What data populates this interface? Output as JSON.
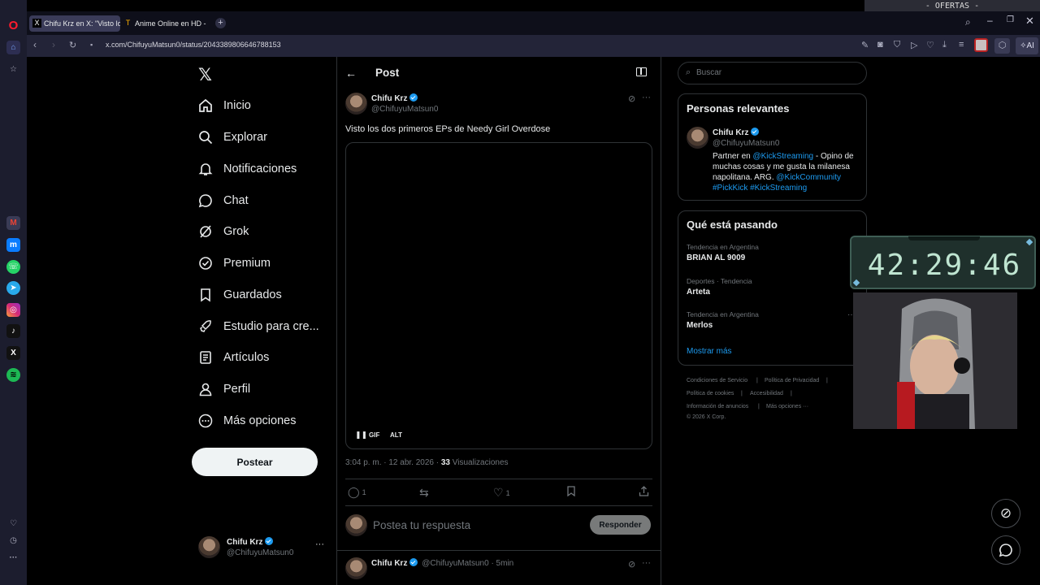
{
  "browser": {
    "ofertas_label": "- OFERTAS -",
    "tabs": [
      {
        "title": "Chifu Krz en X: \"Visto los dos",
        "favicon": "x-icon"
      },
      {
        "title": "Anime Online en HD - Tio Anime",
        "favicon": "tioanime-icon"
      }
    ],
    "url": "x.com/ChifuyuMatsun0/status/2043389806646788153",
    "ai_label": "AI"
  },
  "nav": {
    "items": [
      {
        "label": "Inicio",
        "icon": "home-icon"
      },
      {
        "label": "Explorar",
        "icon": "search-icon"
      },
      {
        "label": "Notificaciones",
        "icon": "bell-icon"
      },
      {
        "label": "Chat",
        "icon": "chat-icon"
      },
      {
        "label": "Grok",
        "icon": "grok-icon"
      },
      {
        "label": "Premium",
        "icon": "premium-icon"
      },
      {
        "label": "Guardados",
        "icon": "bookmark-icon"
      },
      {
        "label": "Estudio para cre...",
        "icon": "rocket-icon"
      },
      {
        "label": "Artículos",
        "icon": "article-icon"
      },
      {
        "label": "Perfil",
        "icon": "person-icon"
      },
      {
        "label": "Más opciones",
        "icon": "more-circle-icon"
      }
    ],
    "post_button": "Postear",
    "account": {
      "name": "Chifu Krz",
      "handle": "@ChifuyuMatsun0"
    }
  },
  "post": {
    "header_title": "Post",
    "author_name": "Chifu Krz",
    "author_handle": "@ChifuyuMatsun0",
    "text": "Visto los dos primeros EPs de Needy Girl Overdose",
    "media_badges": {
      "gif": "GIF",
      "alt": "ALT"
    },
    "timestamp": "3:04 p. m. · 12 abr. 2026 · ",
    "views_count": "33",
    "views_label": " Visualizaciones",
    "actions": {
      "replies": "1",
      "reposts": "",
      "likes": "1"
    },
    "reply_placeholder": "Postea tu respuesta",
    "reply_button": "Responder",
    "reply_preview": {
      "name": "Chifu Krz",
      "handle": "@ChifuyuMatsun0",
      "time": "· 5min"
    }
  },
  "sidebar_right": {
    "search_placeholder": "Buscar",
    "relevant": {
      "title": "Personas relevantes",
      "name": "Chifu Krz",
      "handle": "@ChifuyuMatsun0",
      "bio_1": "Partner en ",
      "bio_link1": "@KickStreaming",
      "bio_2": " - Opino de muchas cosas y me gusta la milanesa napolitana. ARG. ",
      "bio_link2": "@KickCommunity",
      "bio_tags": "#PickKick #KickStreaming"
    },
    "trends": {
      "title": "Qué está pasando",
      "items": [
        {
          "category": "Tendencia en Argentina",
          "name": "BRIAN AL 9009"
        },
        {
          "category": "Deportes · Tendencia",
          "name": "Arteta"
        },
        {
          "category": "Tendencia en Argentina",
          "name": "Merlos"
        }
      ],
      "show_more": "Mostrar más"
    },
    "footer": {
      "terms": "Condiciones de Servicio",
      "privacy": "Política de Privacidad",
      "cookies": "Política de cookies",
      "accessibility": "Accesibilidad",
      "ads": "Información de anuncios",
      "more": "Más opciones ···",
      "copyright": "© 2026 X Corp."
    }
  },
  "overlay": {
    "timer": "42:29:46"
  },
  "colors": {
    "accent": "#1d9bf0",
    "border": "#2f3336",
    "muted": "#71767b",
    "opera_red": "#ff1b2d"
  }
}
